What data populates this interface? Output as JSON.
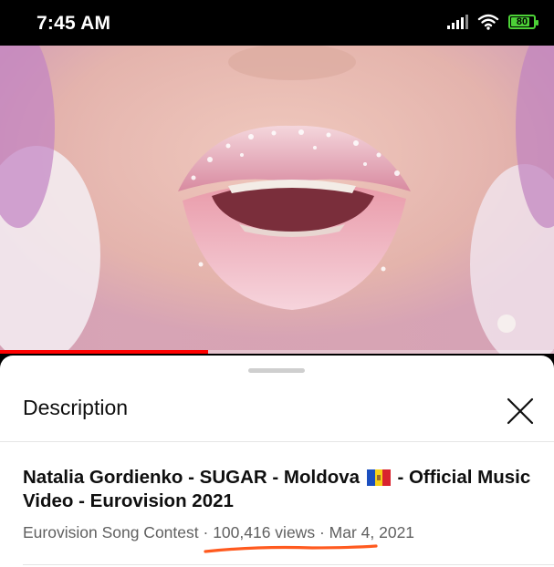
{
  "status_bar": {
    "time": "7:45 AM",
    "battery": "80"
  },
  "player": {
    "progress_percent": 37.5
  },
  "description_panel": {
    "title": "Description",
    "video_title_part1": "Natalia Gordienko - SUGAR - Moldova",
    "video_title_part2": " - Official Music Video - Eurovision 2021",
    "channel": "Eurovision Song Contest",
    "separator": " · ",
    "views": "100,416 views",
    "date": "Mar 4, 2021"
  },
  "colors": {
    "progress": "#ff0000",
    "annotation": "#ff5a1f",
    "battery": "#4cd137"
  },
  "icons": [
    "signal-icon",
    "wifi-icon",
    "battery-icon",
    "close-icon",
    "moldova-flag-icon"
  ]
}
